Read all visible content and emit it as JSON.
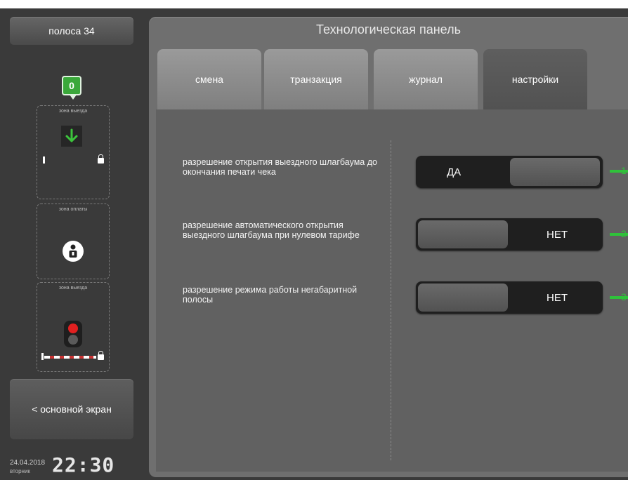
{
  "sidebar": {
    "lane_button": "полоса 34",
    "counter": "0",
    "zones": {
      "exit_top_label": "зона выезда",
      "payment_label": "зона оплаты",
      "exit_bottom_label": "зона выезда"
    },
    "main_screen_button": "< основной экран",
    "date": "24.04.2018",
    "weekday": "вторник",
    "time": "22:30"
  },
  "panel": {
    "title": "Технологическая панель",
    "tabs": [
      {
        "label": "смена"
      },
      {
        "label": "транзакция"
      },
      {
        "label": "журнал"
      },
      {
        "label": "настройки",
        "active": true
      }
    ]
  },
  "settings": [
    {
      "label": "разрешение открытия выездного шлагбаума до  окончания печати чека",
      "value": "ДА",
      "indicator": "1"
    },
    {
      "label": "разрешение автоматического открытия выездного шлагбаума при нулевом тарифе",
      "value": "НЕТ",
      "indicator": "2"
    },
    {
      "label": "разрешение режима работы негабаритной полосы",
      "value": "НЕТ",
      "indicator": "3"
    }
  ],
  "colors": {
    "accent_green": "#2fc23a",
    "badge_green": "#3aa83a",
    "traffic_red": "#e12020"
  },
  "icons": [
    "down-arrow-icon",
    "payment-person-icon",
    "traffic-light-icon",
    "lock-icon"
  ]
}
